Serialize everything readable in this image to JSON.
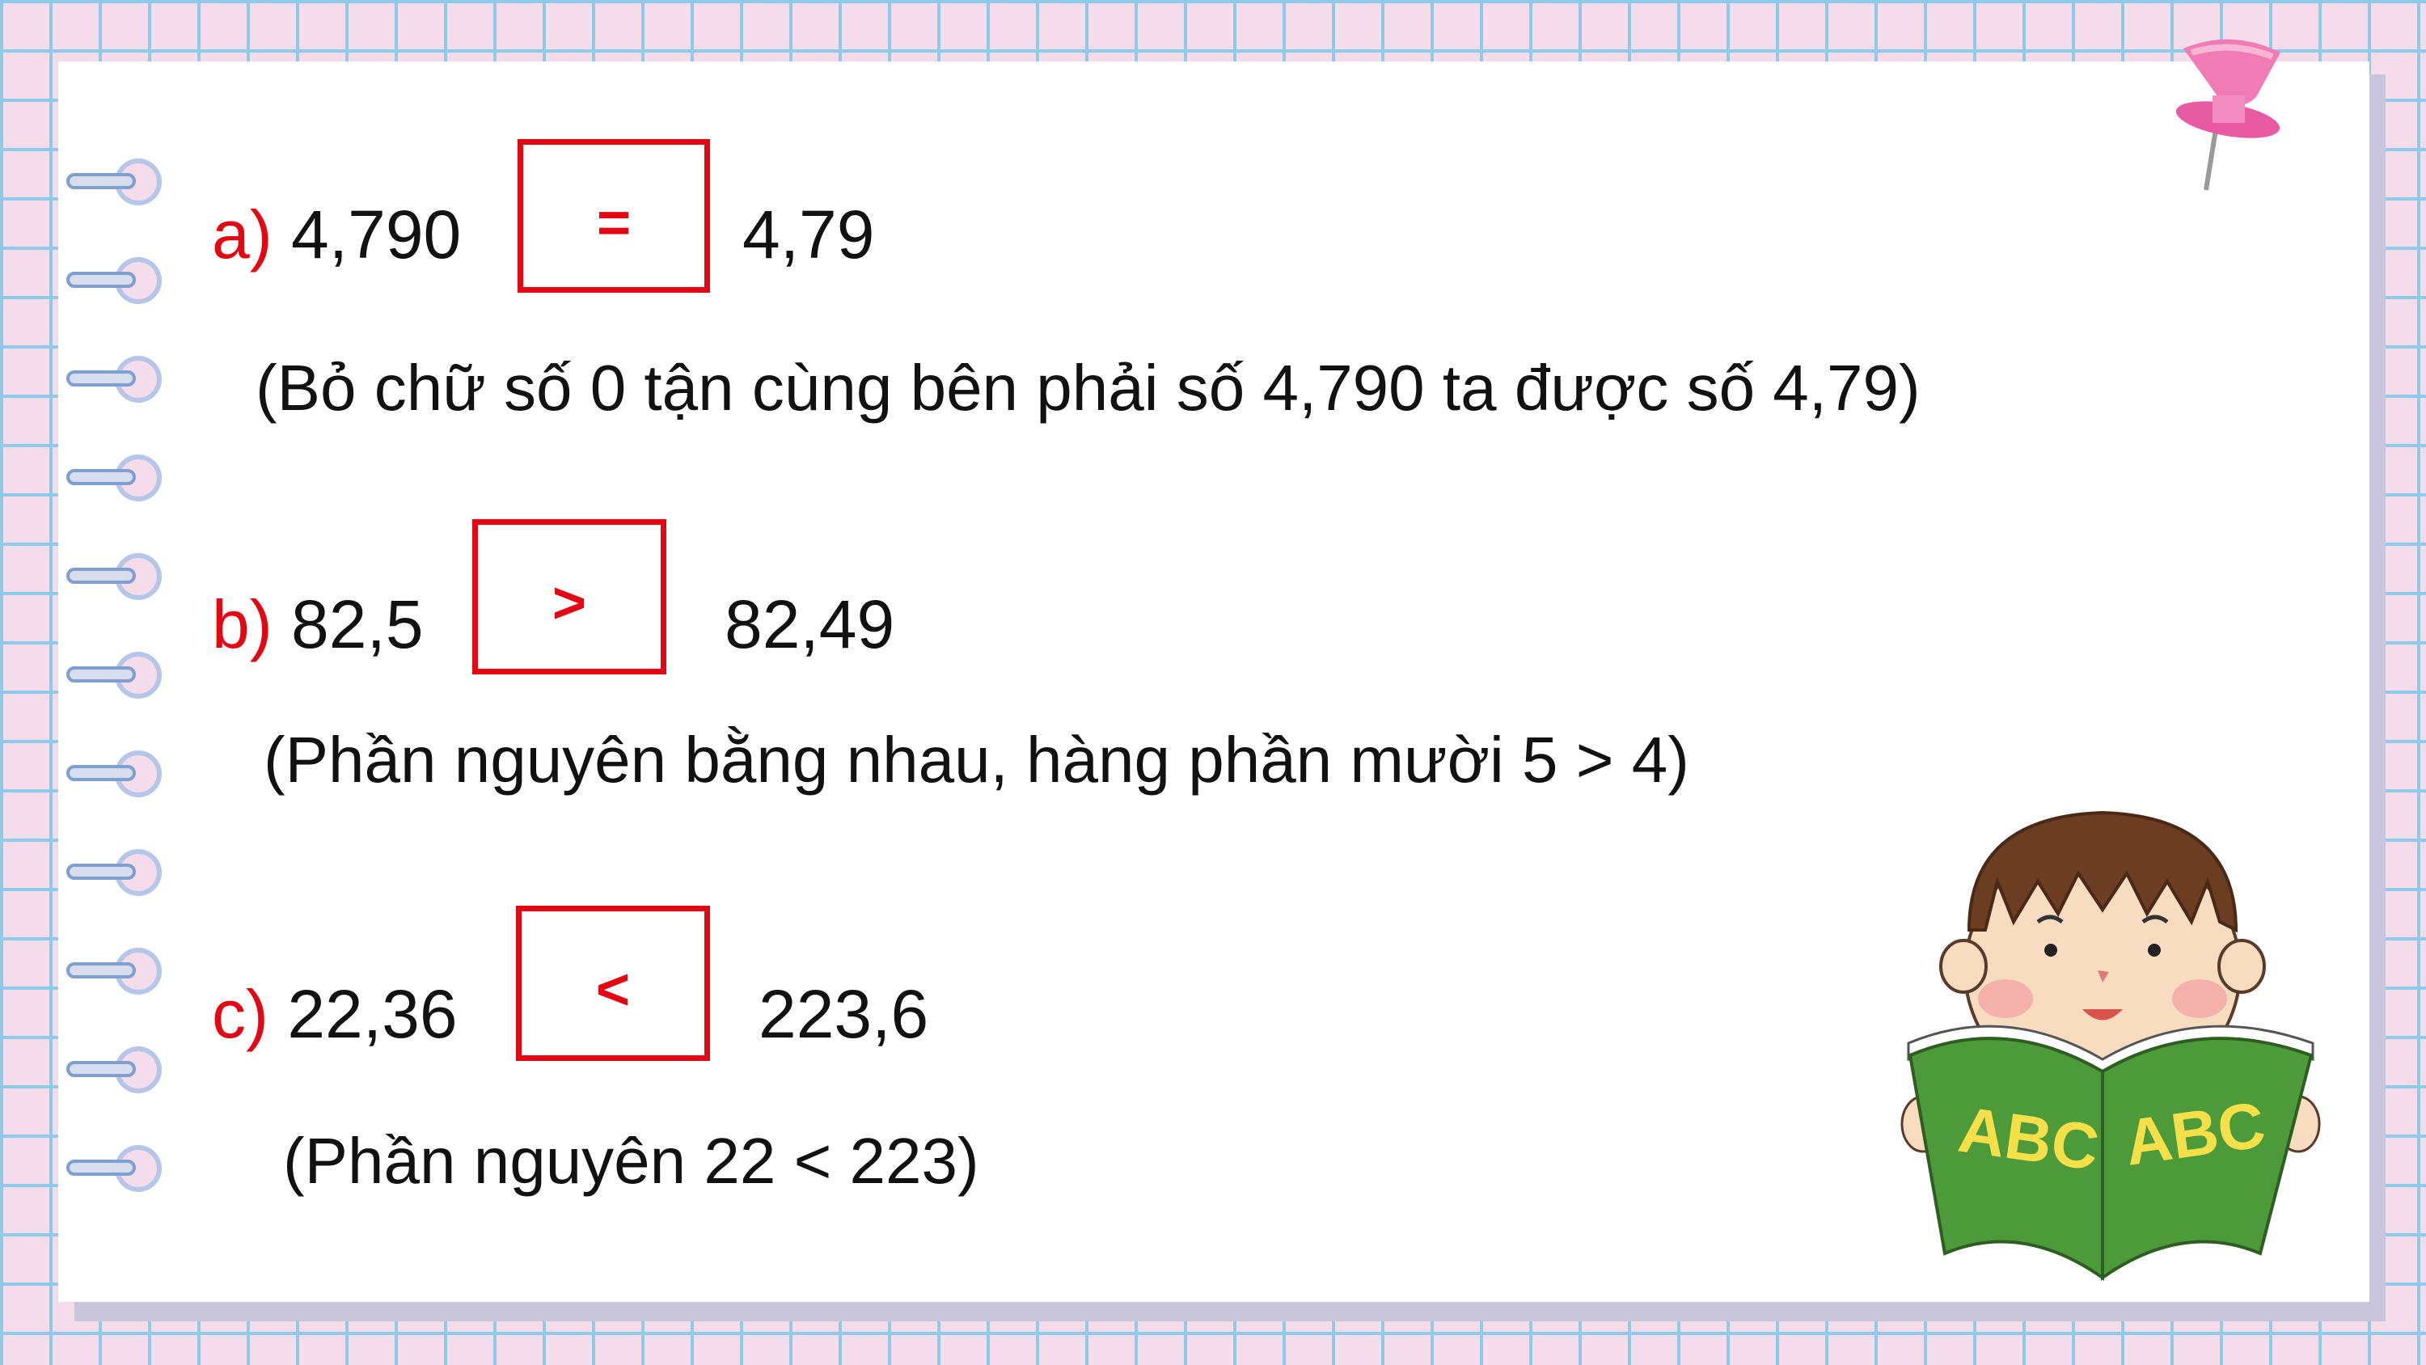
{
  "items": [
    {
      "label": "a)",
      "left": "4,790",
      "sign": "=",
      "right": "4,79",
      "note": "(Bỏ chữ số 0 tận cùng bên phải số 4,790 ta được số 4,79)"
    },
    {
      "label": "b)",
      "left": "82,5",
      "sign": ">",
      "right": "82,49",
      "note": "(Phần nguyên bằng nhau, hàng phần mười 5 > 4)"
    },
    {
      "label": "c)",
      "left": "22,36",
      "sign": "<",
      "right": "223,6",
      "note": "(Phần nguyên 22 < 223)"
    }
  ],
  "illustration": {
    "book_left_text": "ABC",
    "book_right_text": "ABC"
  },
  "colors": {
    "accent_red": "#e30613",
    "grid_blue": "#8fcbe8",
    "background_pink": "#f5dcea",
    "book_green": "#4d9a3a"
  },
  "icons": [
    "push-pin-icon",
    "notebook-ring-icon",
    "boy-reading-book-illustration"
  ]
}
